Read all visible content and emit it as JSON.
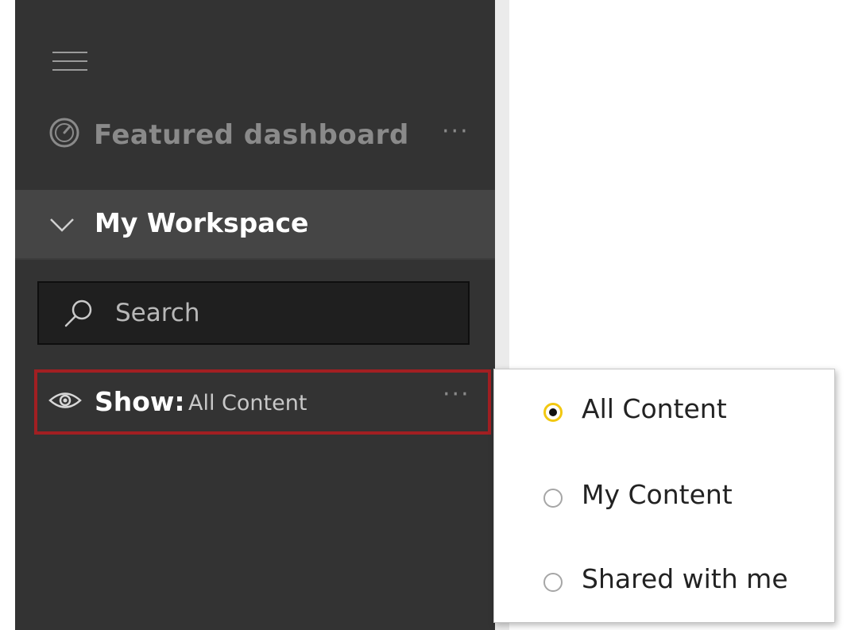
{
  "nav": {
    "featured_label": "Featured dashboard",
    "featured_more": "···",
    "workspace_label": "My Workspace",
    "search": {
      "value": "",
      "placeholder": "Search"
    },
    "show": {
      "label": "Show:",
      "value": "All Content",
      "more": "···"
    }
  },
  "menu": {
    "options": [
      {
        "label": "All Content",
        "selected": true
      },
      {
        "label": "My Content",
        "selected": false
      },
      {
        "label": "Shared with me",
        "selected": false
      }
    ]
  },
  "icons": {
    "menu": "hamburger-icon",
    "featured": "gauge-icon",
    "workspace_toggle": "chevron-down-icon",
    "search": "search-icon",
    "show": "eye-icon"
  },
  "colors": {
    "nav_background": "#333333",
    "workspace_row": "#454545",
    "search_background": "#1f1f1f",
    "highlight_border": "#a21f22",
    "radio_accent": "#f2c811",
    "menu_background": "#ffffff"
  }
}
